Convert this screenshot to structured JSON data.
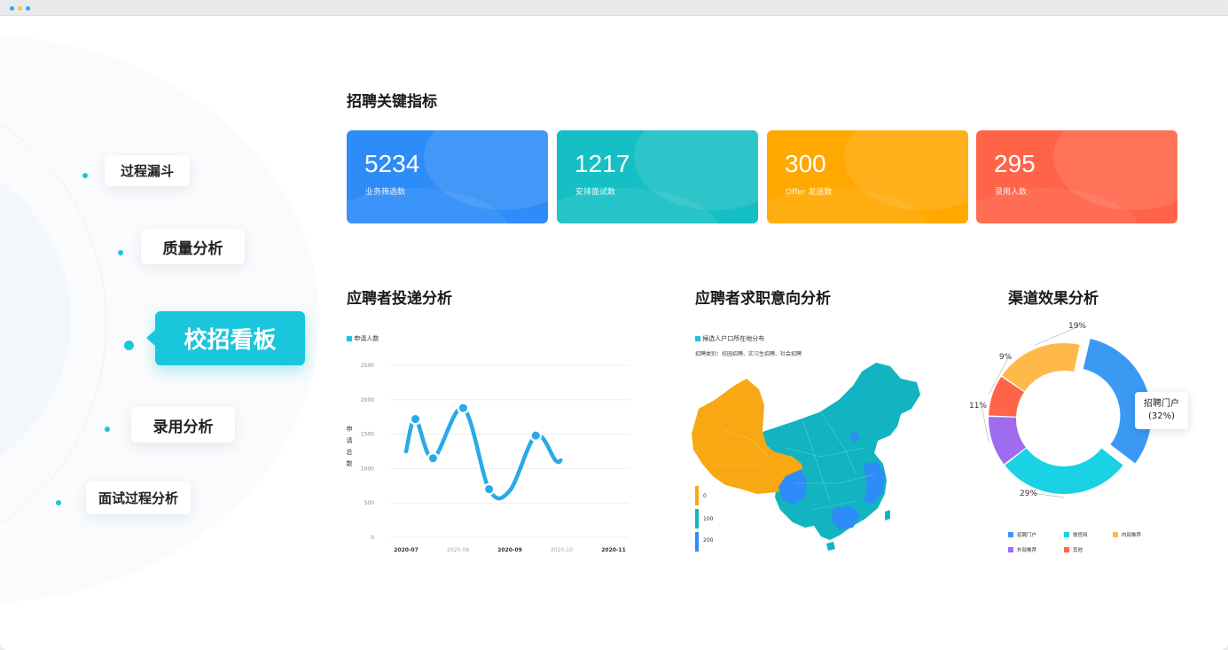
{
  "nav": {
    "items": [
      {
        "label": "过程漏斗"
      },
      {
        "label": "质量分析"
      },
      {
        "label": "校招看板"
      },
      {
        "label": "录用分析"
      },
      {
        "label": "面试过程分析"
      }
    ],
    "active_index": 2
  },
  "kpi_section": {
    "title": "招聘关键指标",
    "cards": [
      {
        "value": "5234",
        "label": "业务筛选数",
        "color": "#2d8cf7"
      },
      {
        "value": "1217",
        "label": "安排面试数",
        "color": "#16bfc4"
      },
      {
        "value": "300",
        "label": "Offer 发送数",
        "color": "#ffa800"
      },
      {
        "value": "295",
        "label": "录用人数",
        "color": "#ff6448"
      }
    ]
  },
  "delivery": {
    "title": "应聘者投递分析",
    "legend": "申请人数",
    "ylabel": "申请总数"
  },
  "intent": {
    "title": "应聘者求职意向分析",
    "legend": "候选人户口所在地分布",
    "subtitle": "招聘类别：校园招聘、实习生招聘、社会招聘",
    "scale": [
      "0",
      "100",
      "200"
    ]
  },
  "channel": {
    "title": "渠道效果分析",
    "tooltip_line1": "招聘门户",
    "tooltip_line2": "(32%)"
  },
  "chart_data": [
    {
      "type": "line",
      "x": [
        "2020-07",
        "2020-08",
        "2020-09",
        "2020-10",
        "2020-11"
      ],
      "y_ticks": [
        "0",
        "500",
        "1000",
        "1500",
        "2000",
        "2500"
      ],
      "ylim": [
        0,
        2500
      ],
      "ylabel": "申请总数",
      "series": [
        {
          "name": "申请人数",
          "points": [
            [
              0,
              1250
            ],
            [
              0.18,
              1720
            ],
            [
              0.52,
              1150
            ],
            [
              1.1,
              1880
            ],
            [
              1.6,
              700
            ],
            [
              2.0,
              680
            ],
            [
              2.5,
              1480
            ],
            [
              2.88,
              1120
            ],
            [
              2.98,
              1120
            ]
          ]
        }
      ],
      "markers": [
        [
          0.18,
          1720
        ],
        [
          0.52,
          1150
        ],
        [
          1.1,
          1880
        ],
        [
          1.6,
          700
        ],
        [
          2.5,
          1480
        ]
      ],
      "color": "#29a9e8"
    },
    {
      "type": "pie",
      "donut": true,
      "slices": [
        {
          "name": "招聘门户",
          "value": 32,
          "label": "",
          "color": "#3a9af3"
        },
        {
          "name": "微官网",
          "value": 29,
          "label": "29%",
          "color": "#19d2e3"
        },
        {
          "name": "外部推荐",
          "value": 11,
          "label": "11%",
          "color": "#9f6cf0"
        },
        {
          "name": "其他",
          "value": 9,
          "label": "9%",
          "color": "#ff6448"
        },
        {
          "name": "内部推荐",
          "value": 19,
          "label": "19%",
          "color": "#ffb94a"
        }
      ],
      "legend": [
        "招聘门户",
        "微官网",
        "内部推荐",
        "外部推荐",
        "其他"
      ]
    }
  ],
  "colors": {
    "accent": "#19c6dc",
    "map_orange": "#f7a812",
    "map_teal": "#11b4c0",
    "map_blue": "#2d8cf7"
  }
}
